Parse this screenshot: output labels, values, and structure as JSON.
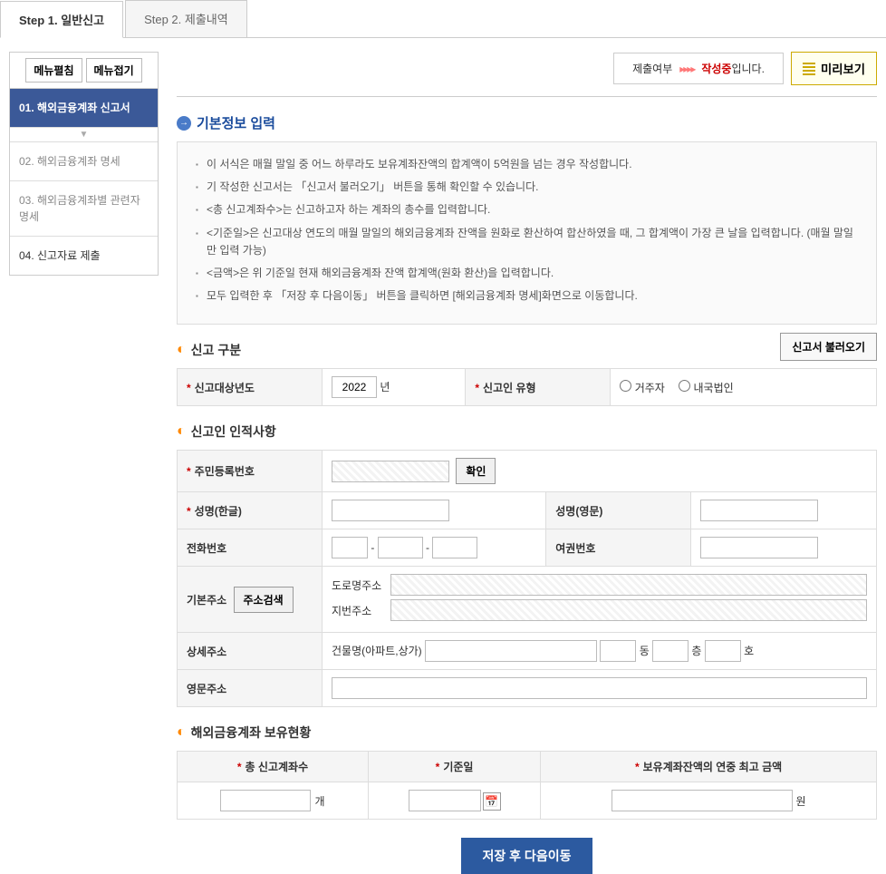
{
  "tabs": [
    {
      "label": "Step 1. 일반신고",
      "active": true
    },
    {
      "label": "Step 2. 제출내역",
      "active": false
    }
  ],
  "menu_buttons": {
    "expand": "메뉴펼침",
    "collapse": "메뉴접기"
  },
  "sidebar": {
    "items": [
      {
        "label": "01. 해외금융계좌 신고서",
        "active": true
      },
      {
        "label": "02. 해외금융계좌 명세",
        "active": false
      },
      {
        "label": "03. 해외금융계좌별 관련자 명세",
        "active": false
      },
      {
        "label": "04. 신고자료 제출",
        "active": false
      }
    ]
  },
  "status": {
    "label": "제출여부",
    "value": "작성중",
    "suffix": "입니다.",
    "preview": "미리보기"
  },
  "main_title": "기본정보 입력",
  "info_list": [
    "이 서식은 매월 말일 중 어느 하루라도 보유계좌잔액의 합계액이 5억원을 넘는 경우 작성합니다.",
    "기 작성한 신고서는 「신고서 불러오기」 버튼을 통해 확인할 수 있습니다.",
    "<총 신고계좌수>는 신고하고자 하는 계좌의 총수를 입력합니다.",
    "<기준일>은 신고대상 연도의 매월 말일의 해외금융계좌 잔액을 원화로 환산하여 합산하였을 때, 그 합계액이 가장 큰 날을 입력합니다. (매월 말일만 입력 가능)",
    "<금액>은 위 기준일 현재 해외금융계좌 잔액 합계액(원화 환산)을 입력합니다.",
    "모두 입력한 후 「저장 후 다음이동」 버튼을 클릭하면 [해외금융계좌 명세]화면으로 이동합니다."
  ],
  "sections": {
    "report_type": {
      "title": "신고 구분",
      "load_btn": "신고서 불러오기"
    },
    "personal": {
      "title": "신고인 인적사항"
    },
    "holdings": {
      "title": "해외금융계좌 보유현황"
    }
  },
  "form": {
    "year_label": "신고대상년도",
    "year_value": "2022",
    "year_unit": "년",
    "type_label": "신고인 유형",
    "type_options": [
      "거주자",
      "내국법인"
    ],
    "rrn_label": "주민등록번호",
    "rrn_confirm": "확인",
    "name_kr_label": "성명(한글)",
    "name_en_label": "성명(영문)",
    "phone_label": "전화번호",
    "passport_label": "여권번호",
    "addr_base_label": "기본주소",
    "addr_search": "주소검색",
    "addr_road_label": "도로명주소",
    "addr_jibun_label": "지번주소",
    "addr_detail_label": "상세주소",
    "addr_building_label": "건물명(아파트,상가)",
    "addr_dong": "동",
    "addr_floor": "층",
    "addr_ho": "호",
    "addr_en_label": "영문주소"
  },
  "holdings": {
    "col_count": "총 신고계좌수",
    "count_unit": "개",
    "col_date": "기준일",
    "col_amount": "보유계좌잔액의 연중 최고 금액",
    "amount_unit": "원"
  },
  "submit": "저장 후 다음이동"
}
